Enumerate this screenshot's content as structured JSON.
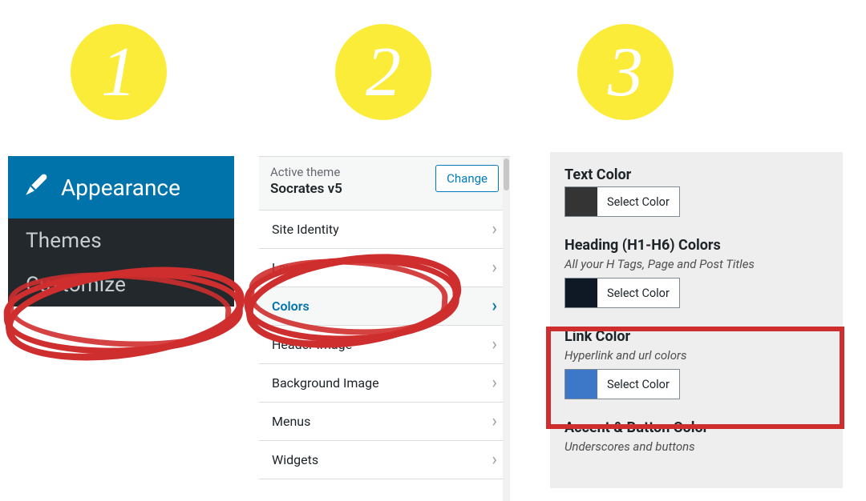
{
  "badges": {
    "one": "1",
    "two": "2",
    "three": "3"
  },
  "panel1": {
    "header": "Appearance",
    "items": [
      "Themes",
      "Customize"
    ]
  },
  "panel2": {
    "active_theme_label": "Active theme",
    "active_theme_name": "Socrates v5",
    "change_btn": "Change",
    "items": [
      {
        "label": "Site Identity"
      },
      {
        "label": "Layout"
      },
      {
        "label": "Colors",
        "active": true
      },
      {
        "label": "Header Image"
      },
      {
        "label": "Background Image"
      },
      {
        "label": "Menus"
      },
      {
        "label": "Widgets"
      }
    ]
  },
  "panel3": {
    "sections": [
      {
        "title": "Text Color",
        "subtitle": "",
        "swatch": "dark",
        "btn": "Select Color"
      },
      {
        "title": "Heading (H1-H6) Colors",
        "subtitle": "All your H Tags, Page and Post Titles",
        "swatch": "navy",
        "btn": "Select Color"
      },
      {
        "title": "Link Color",
        "subtitle": "Hyperlink and url colors",
        "swatch": "link",
        "btn": "Select Color",
        "highlighted": true
      },
      {
        "title": "Accent & Button Color",
        "subtitle": "Underscores and buttons"
      }
    ]
  },
  "colors": {
    "accent": "#0073aa",
    "badge": "#fcec3a",
    "annotation": "#cf2e2e"
  }
}
